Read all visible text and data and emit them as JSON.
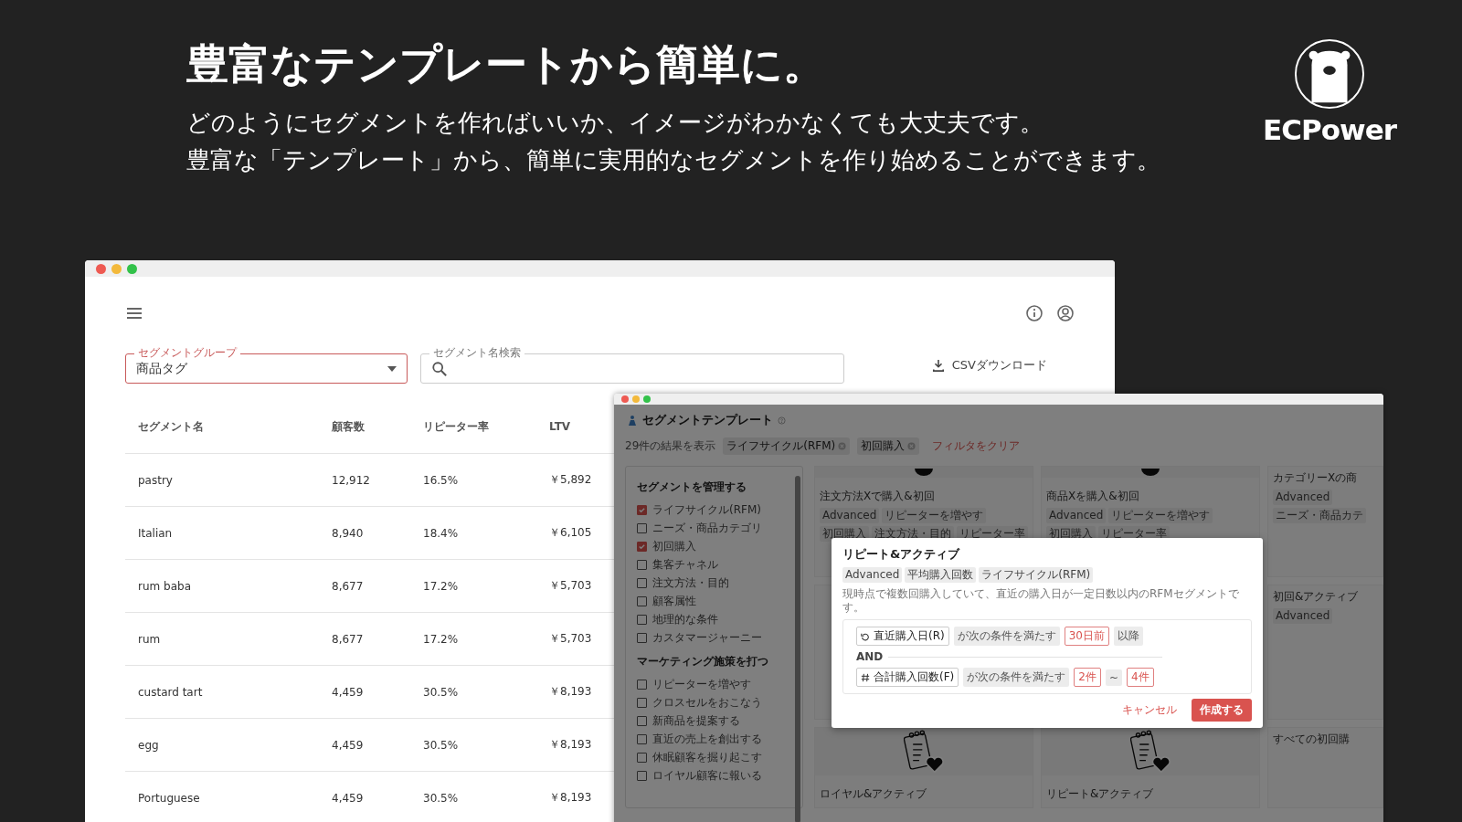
{
  "headline": "豊富なテンプレートから簡単に。",
  "intro": [
    "どのようにセグメントを作ればいいか、イメージがわかなくても大丈夫です。",
    "豊富な「テンプレート」から、簡単に実用的なセグメントを作り始めることができます。"
  ],
  "brand": "ECPower",
  "segment_window": {
    "group_field": {
      "label": "セグメントグループ",
      "value": "商品タグ"
    },
    "search_field": {
      "label": "セグメント名検索"
    },
    "csv_button": "CSVダウンロード",
    "table": {
      "columns": [
        "セグメント名",
        "顧客数",
        "リピーター率",
        "LTV"
      ],
      "rows": [
        [
          "pastry",
          "12,912",
          "16.5%",
          "￥5,892"
        ],
        [
          "Italian",
          "8,940",
          "18.4%",
          "￥6,105"
        ],
        [
          "rum baba",
          "8,677",
          "17.2%",
          "￥5,703"
        ],
        [
          "rum",
          "8,677",
          "17.2%",
          "￥5,703"
        ],
        [
          "custard tart",
          "4,459",
          "30.5%",
          "￥8,193"
        ],
        [
          "egg",
          "4,459",
          "30.5%",
          "￥8,193"
        ],
        [
          "Portuguese",
          "4,459",
          "30.5%",
          "￥8,193"
        ]
      ]
    }
  },
  "template_window": {
    "title": "セグメントテンプレート",
    "result_count": "29件の結果を表示",
    "filters": [
      "ライフサイクル(RFM)",
      "初回購入"
    ],
    "clear_filters": "フィルタをクリア",
    "sidebar": {
      "groups": [
        {
          "heading": "セグメントを管理する",
          "items": [
            {
              "label": "ライフサイクル(RFM)",
              "checked": true
            },
            {
              "label": "ニーズ・商品カテゴリ",
              "checked": false
            },
            {
              "label": "初回購入",
              "checked": true
            },
            {
              "label": "集客チャネル",
              "checked": false
            },
            {
              "label": "注文方法・目的",
              "checked": false
            },
            {
              "label": "顧客属性",
              "checked": false
            },
            {
              "label": "地理的な条件",
              "checked": false
            },
            {
              "label": "カスタマージャーニー",
              "checked": false
            }
          ]
        },
        {
          "heading": "マーケティング施策を打つ",
          "items": [
            {
              "label": "リピーターを増やす",
              "checked": false
            },
            {
              "label": "クロスセルをおこなう",
              "checked": false
            },
            {
              "label": "新商品を提案する",
              "checked": false
            },
            {
              "label": "直近の売上を創出する",
              "checked": false
            },
            {
              "label": "休眠顧客を掘り起こす",
              "checked": false
            },
            {
              "label": "ロイヤル顧客に報いる",
              "checked": false
            }
          ]
        }
      ]
    },
    "card_rows": [
      [
        {
          "kind": "teaser",
          "title": "注文方法Xで購入&初回",
          "tags": [
            "Advanced",
            "リピーターを増やす",
            "初回購入",
            "注文方法・目的",
            "リピーター率"
          ]
        },
        {
          "kind": "teaser",
          "title": "商品Xを購入&初回",
          "tags": [
            "Advanced",
            "リピーターを増やす",
            "初回購入",
            "リピーター率"
          ]
        },
        {
          "kind": "plain",
          "title": "カテゴリーXの商",
          "tags": [
            "Advanced",
            "ニーズ・商品カテ"
          ]
        }
      ],
      [
        {
          "kind": "plain",
          "title": "初回&アクティブ",
          "tags": [
            "Advanced"
          ]
        }
      ],
      [
        {
          "kind": "illustrated",
          "title": "ロイヤル&アクティブ"
        },
        {
          "kind": "illustrated",
          "title": "リピート&アクティブ"
        },
        {
          "kind": "plain",
          "title": "すべての初回購"
        }
      ]
    ],
    "modal": {
      "title": "リピート&アクティブ",
      "tags": [
        "Advanced",
        "平均購入回数",
        "ライフサイクル(RFM)"
      ],
      "description": "現時点で複数回購入していて、直近の購入日が一定日数以内のRFMセグメントです。",
      "conditions": [
        {
          "kind": "row",
          "parts": [
            {
              "kind": "date_field",
              "text": "直近購入日(R)"
            },
            {
              "kind": "op",
              "text": "が次の条件を満たす"
            },
            {
              "kind": "value",
              "text": "30日前"
            },
            {
              "kind": "op",
              "text": "以降"
            }
          ]
        },
        {
          "kind": "separator",
          "text": "AND"
        },
        {
          "kind": "row",
          "parts": [
            {
              "kind": "count_field",
              "text": "合計購入回数(F)"
            },
            {
              "kind": "op",
              "text": "が次の条件を満たす"
            },
            {
              "kind": "value",
              "text": "2件"
            },
            {
              "kind": "op",
              "text": "~"
            },
            {
              "kind": "value",
              "text": "4件"
            }
          ]
        }
      ],
      "cancel": "キャンセル",
      "submit": "作成する"
    }
  }
}
